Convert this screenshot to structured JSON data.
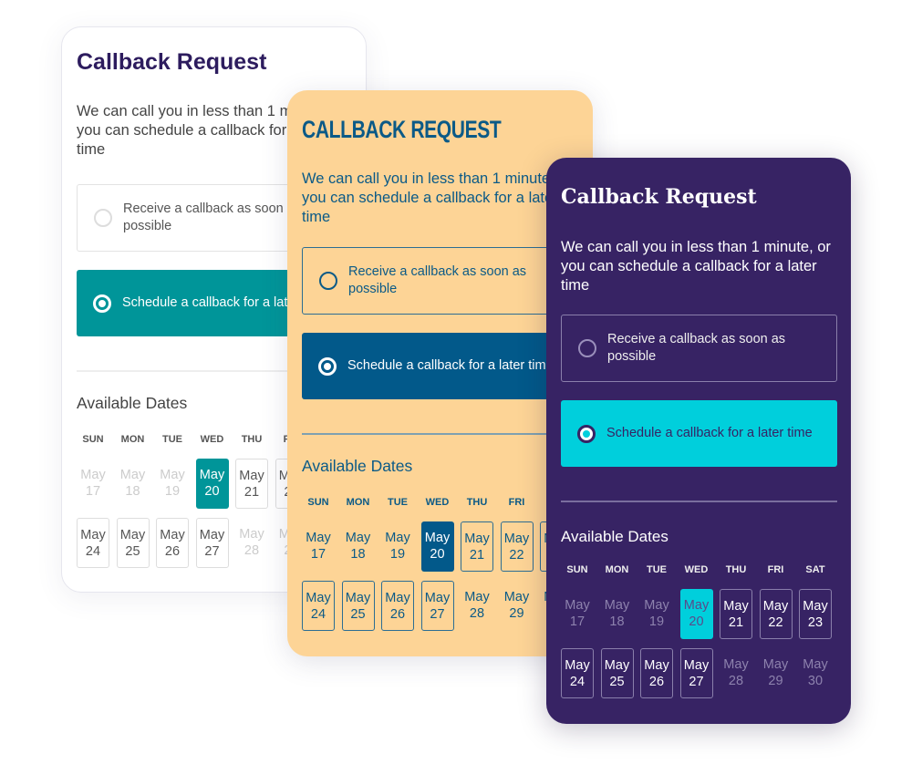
{
  "cards": [
    {
      "theme": "white",
      "title": "Callback Request",
      "description": "We can call you in less than 1 minute, or you can schedule a callback for a later time",
      "options": [
        "Receive a callback as soon as possible",
        "Schedule a callback for a later time"
      ],
      "selected_option": 1,
      "available_dates_label": "Available Dates",
      "colors": {
        "accent": "#009599",
        "title": "#2d1c5e",
        "background": "#ffffff"
      }
    },
    {
      "theme": "peach",
      "title": "CALLBACK REQUEST",
      "description": "We can call you in less than 1 minute, or you can schedule a callback for a later time",
      "options": [
        "Receive a callback as soon as possible",
        "Schedule a callback for a later time"
      ],
      "selected_option": 1,
      "available_dates_label": "Available Dates",
      "colors": {
        "accent": "#02598a",
        "background": "#fdd496"
      }
    },
    {
      "theme": "purple",
      "title": "Callback Request",
      "description": "We can call you in less than 1 minute, or you can schedule a callback for a later time",
      "options": [
        "Receive a callback as soon as possible",
        "Schedule a callback for a later time"
      ],
      "selected_option": 1,
      "available_dates_label": "Available Dates",
      "colors": {
        "accent": "#00cfdc",
        "background": "#372364"
      }
    }
  ],
  "calendar": {
    "weekdays": [
      "SUN",
      "MON",
      "TUE",
      "WED",
      "THU",
      "FRI",
      "SAT"
    ],
    "weeks": [
      [
        {
          "month": "May",
          "day": "17",
          "state": "disabled"
        },
        {
          "month": "May",
          "day": "18",
          "state": "disabled"
        },
        {
          "month": "May",
          "day": "19",
          "state": "disabled"
        },
        {
          "month": "May",
          "day": "20",
          "state": "selected"
        },
        {
          "month": "May",
          "day": "21",
          "state": "available"
        },
        {
          "month": "May",
          "day": "22",
          "state": "available"
        },
        {
          "month": "May",
          "day": "23",
          "state": "available"
        }
      ],
      [
        {
          "month": "May",
          "day": "24",
          "state": "available"
        },
        {
          "month": "May",
          "day": "25",
          "state": "available"
        },
        {
          "month": "May",
          "day": "26",
          "state": "available"
        },
        {
          "month": "May",
          "day": "27",
          "state": "available"
        },
        {
          "month": "May",
          "day": "28",
          "state": "disabled"
        },
        {
          "month": "May",
          "day": "29",
          "state": "disabled"
        },
        {
          "month": "May",
          "day": "30",
          "state": "disabled"
        }
      ]
    ]
  }
}
